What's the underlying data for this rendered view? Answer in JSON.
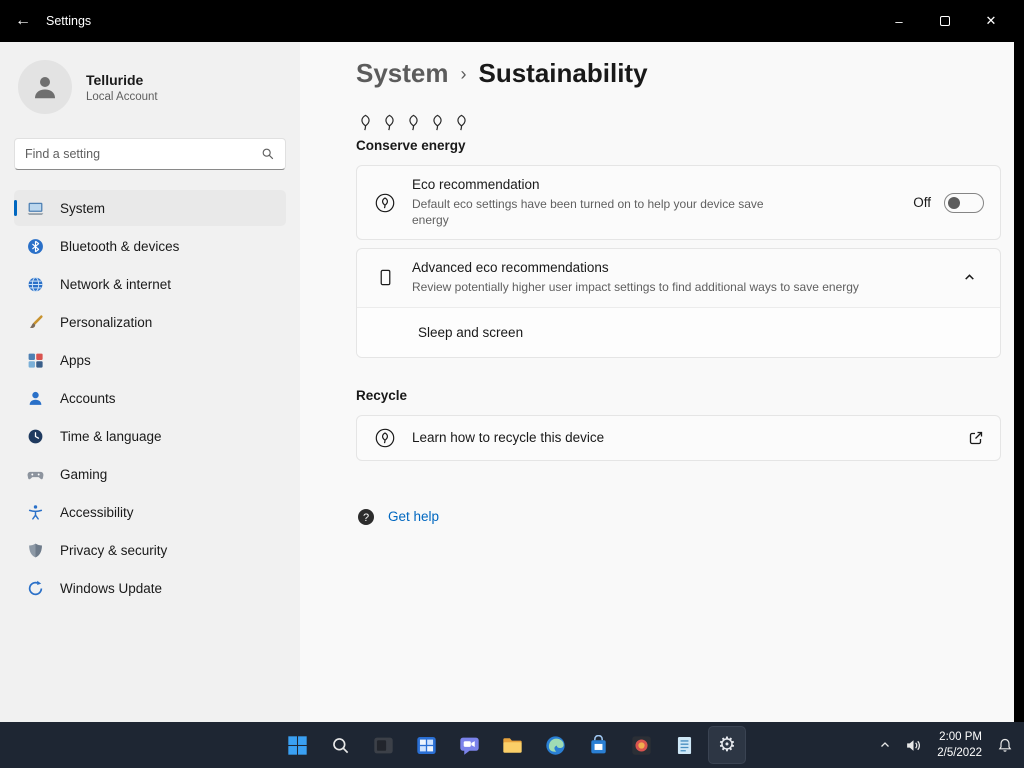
{
  "titlebar": {
    "title": "Settings"
  },
  "sidebar": {
    "user": {
      "name": "Telluride",
      "type": "Local Account"
    },
    "search_placeholder": "Find a setting",
    "items": [
      {
        "label": "System",
        "icon": "system-icon",
        "selected": true
      },
      {
        "label": "Bluetooth & devices",
        "icon": "bluetooth-icon",
        "selected": false
      },
      {
        "label": "Network & internet",
        "icon": "network-icon",
        "selected": false
      },
      {
        "label": "Personalization",
        "icon": "personalization-icon",
        "selected": false
      },
      {
        "label": "Apps",
        "icon": "apps-icon",
        "selected": false
      },
      {
        "label": "Accounts",
        "icon": "accounts-icon",
        "selected": false
      },
      {
        "label": "Time & language",
        "icon": "time-language-icon",
        "selected": false
      },
      {
        "label": "Gaming",
        "icon": "gaming-icon",
        "selected": false
      },
      {
        "label": "Accessibility",
        "icon": "accessibility-icon",
        "selected": false
      },
      {
        "label": "Privacy & security",
        "icon": "privacy-icon",
        "selected": false
      },
      {
        "label": "Windows Update",
        "icon": "windows-update-icon",
        "selected": false
      }
    ]
  },
  "main": {
    "breadcrumb": {
      "root": "System",
      "separator": "›",
      "current": "Sustainability"
    },
    "conserve": {
      "heading": "Conserve energy",
      "eco_card": {
        "title": "Eco recommendation",
        "description": "Default eco settings have been turned on to help your device save energy",
        "toggle_state": "Off"
      },
      "advanced_card": {
        "title": "Advanced eco recommendations",
        "description": "Review potentially higher user impact settings to find additional ways to save energy",
        "expanded_item": "Sleep and screen"
      }
    },
    "recycle": {
      "heading": "Recycle",
      "card_title": "Learn how to recycle this device"
    },
    "get_help_label": "Get help"
  },
  "taskbar": {
    "icons": [
      "start-icon",
      "search-icon",
      "task-view-icon",
      "widgets-icon",
      "chat-icon",
      "file-explorer-icon",
      "edge-icon",
      "store-icon",
      "photos-icon",
      "notepad-icon",
      "settings-icon"
    ],
    "active_icon": "settings-icon",
    "tray": {
      "time": "2:00 PM",
      "date": "2/5/2022"
    }
  },
  "colors": {
    "accent": "#0067c0",
    "titlebar_bg": "#000000",
    "taskbar_bg": "#1e2633"
  }
}
